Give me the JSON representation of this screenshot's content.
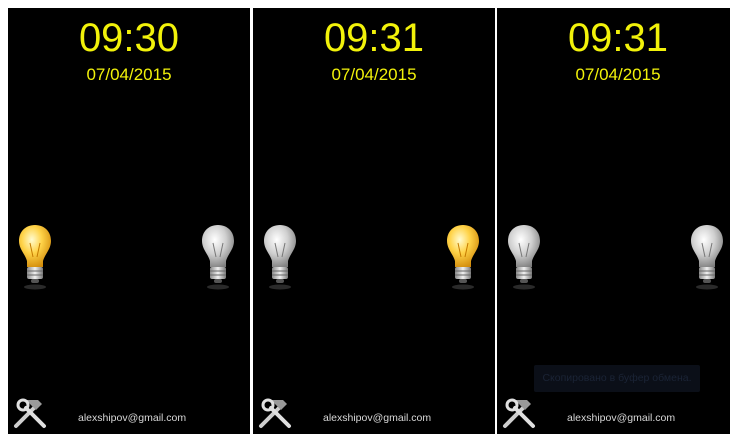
{
  "panels": [
    {
      "time": "09:30",
      "date": "07/04/2015",
      "email": "alexshipov@gmail.com",
      "bulbs": [
        {
          "state": "on"
        },
        {
          "state": "off"
        }
      ]
    },
    {
      "time": "09:31",
      "date": "07/04/2015",
      "email": "alexshipov@gmail.com",
      "bulbs": [
        {
          "state": "off"
        },
        {
          "state": "on"
        }
      ]
    },
    {
      "time": "09:31",
      "date": "07/04/2015",
      "email": "alexshipov@gmail.com",
      "bulbs": [
        {
          "state": "off"
        },
        {
          "state": "off"
        }
      ],
      "toast": "Скопировано в буфер обмена."
    }
  ],
  "colors": {
    "clock": "#f2f20a",
    "background": "#000000",
    "email": "#d8d8d8"
  },
  "icons": {
    "settings": "hammer-wrench-icon",
    "bulb_on": "lightbulb-on-icon",
    "bulb_off": "lightbulb-off-icon"
  }
}
